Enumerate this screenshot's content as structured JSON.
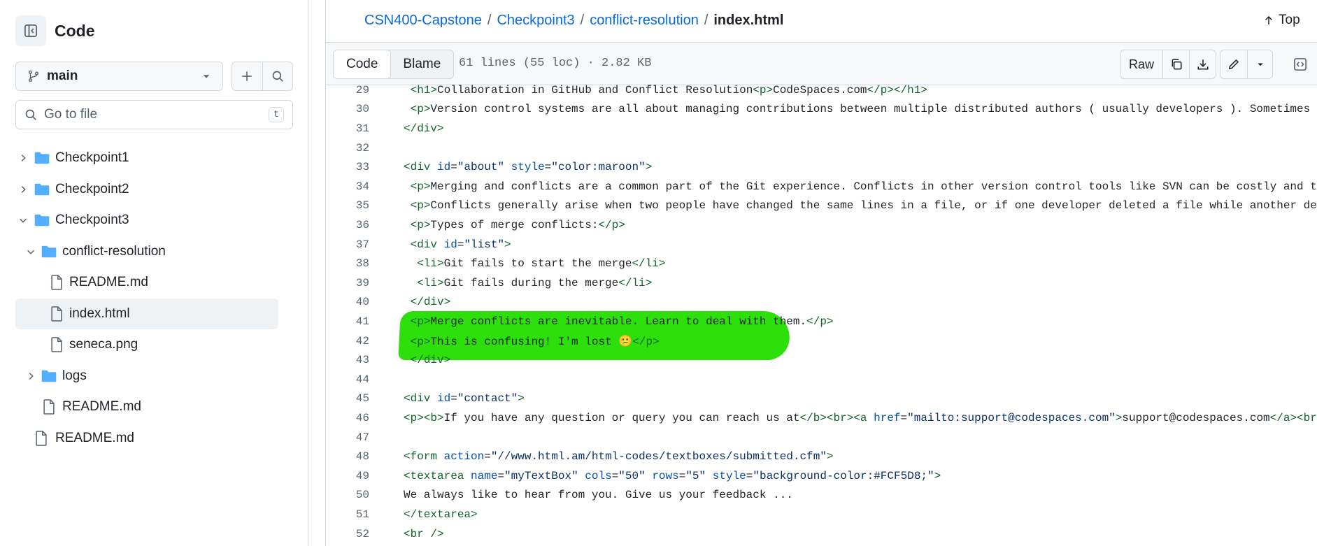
{
  "sidebar": {
    "title": "Code",
    "branch": "main",
    "search": {
      "placeholder": "Go to file",
      "shortcut": "t"
    },
    "tree": [
      {
        "label": "Checkpoint1",
        "type": "folder",
        "level": 0,
        "expanded": false
      },
      {
        "label": "Checkpoint2",
        "type": "folder",
        "level": 0,
        "expanded": false
      },
      {
        "label": "Checkpoint3",
        "type": "folder",
        "level": 0,
        "expanded": true
      },
      {
        "label": "conflict-resolution",
        "type": "folder",
        "level": 1,
        "expanded": true
      },
      {
        "label": "README.md",
        "type": "file",
        "level": 2
      },
      {
        "label": "index.html",
        "type": "file",
        "level": 2,
        "active": true
      },
      {
        "label": "seneca.png",
        "type": "file",
        "level": 2
      },
      {
        "label": "logs",
        "type": "folder",
        "level": 1,
        "expanded": false
      },
      {
        "label": "README.md",
        "type": "file",
        "level": 1
      },
      {
        "label": "README.md",
        "type": "file",
        "level": 0
      }
    ]
  },
  "breadcrumb": {
    "parts": [
      "CSN400-Capstone",
      "Checkpoint3",
      "conflict-resolution"
    ],
    "separator": "/",
    "current": "index.html"
  },
  "top_link": "Top",
  "toolbar": {
    "code_tab": "Code",
    "blame_tab": "Blame",
    "file_info": "61 lines (55 loc) · 2.82 KB",
    "raw": "Raw"
  },
  "colors": {
    "highlight": "#2de00b",
    "link": "#0969da"
  },
  "code": {
    "lines": [
      {
        "n": "29",
        "html": " <span class='tk-tag'>&lt;h1&gt;</span>Collaboration in GitHub and Conflict Resolution<span class='tk-tag'>&lt;p&gt;</span>CodeSpaces.com<span class='tk-tag'>&lt;/p&gt;&lt;/h1&gt;</span>"
      },
      {
        "n": "30",
        "html": " <span class='tk-tag'>&lt;p&gt;</span>Version control systems are all about managing contributions between multiple distributed authors ( usually developers ). Sometimes multiple"
      },
      {
        "n": "31",
        "html": "<span class='tk-tag'>&lt;/div&gt;</span>"
      },
      {
        "n": "32",
        "html": ""
      },
      {
        "n": "33",
        "html": "<span class='tk-tag'>&lt;div</span> <span class='tk-attr'>id</span>=<span class='tk-str'>\"about\"</span> <span class='tk-attr'>style</span>=<span class='tk-str'>\"color:maroon\"</span><span class='tk-tag'>&gt;</span>"
      },
      {
        "n": "34",
        "html": " <span class='tk-tag'>&lt;p&gt;</span>Merging and conflicts are a common part of the Git experience. Conflicts in other version control tools like SVN can be costly and time-cons"
      },
      {
        "n": "35",
        "html": " <span class='tk-tag'>&lt;p&gt;</span>Conflicts generally arise when two people have changed the same lines in a file, or if one developer deleted a file while another developer"
      },
      {
        "n": "36",
        "html": " <span class='tk-tag'>&lt;p&gt;</span>Types of merge conflicts:<span class='tk-tag'>&lt;/p&gt;</span>"
      },
      {
        "n": "37",
        "html": " <span class='tk-tag'>&lt;div</span> <span class='tk-attr'>id</span>=<span class='tk-str'>\"list\"</span><span class='tk-tag'>&gt;</span>"
      },
      {
        "n": "38",
        "html": "  <span class='tk-tag'>&lt;li&gt;</span>Git fails to start the merge<span class='tk-tag'>&lt;/li&gt;</span>"
      },
      {
        "n": "39",
        "html": "  <span class='tk-tag'>&lt;li&gt;</span>Git fails during the merge<span class='tk-tag'>&lt;/li&gt;</span>"
      },
      {
        "n": "40",
        "html": " <span class='tk-tag'>&lt;/div&gt;</span>"
      },
      {
        "n": "41",
        "html": " <span class='tk-tag'>&lt;p&gt;</span>Merge conflicts are inevitable. Learn to deal with them.<span class='tk-tag'>&lt;/p&gt;</span>"
      },
      {
        "n": "42",
        "html": " <span class='tk-tag'>&lt;p&gt;</span>This is confusing! I'm lost 😕<span class='tk-tag'>&lt;/p&gt;</span>"
      },
      {
        "n": "43",
        "html": " <span class='tk-tag'>&lt;/div&gt;</span>"
      },
      {
        "n": "44",
        "html": ""
      },
      {
        "n": "45",
        "html": "<span class='tk-tag'>&lt;div</span> <span class='tk-attr'>id</span>=<span class='tk-str'>\"contact\"</span><span class='tk-tag'>&gt;</span>"
      },
      {
        "n": "46",
        "html": "<span class='tk-tag'>&lt;p&gt;&lt;b&gt;</span>If you have any question or query you can reach us at<span class='tk-tag'>&lt;/b&gt;&lt;br&gt;&lt;a</span> <span class='tk-attr'>href</span>=<span class='tk-str'>\"mailto:support@codespaces.com\"</span><span class='tk-tag'>&gt;</span>support@codespaces.com<span class='tk-tag'>&lt;/a&gt;&lt;br&gt;&lt;br&gt;&lt;/p</span>"
      },
      {
        "n": "47",
        "html": ""
      },
      {
        "n": "48",
        "html": "<span class='tk-tag'>&lt;form</span> <span class='tk-attr'>action</span>=<span class='tk-str'>\"//www.html.am/html-codes/textboxes/submitted.cfm\"</span><span class='tk-tag'>&gt;</span>"
      },
      {
        "n": "49",
        "html": "<span class='tk-tag'>&lt;textarea</span> <span class='tk-attr'>name</span>=<span class='tk-str'>\"myTextBox\"</span> <span class='tk-attr'>cols</span>=<span class='tk-str'>\"50\"</span> <span class='tk-attr'>rows</span>=<span class='tk-str'>\"5\"</span> <span class='tk-attr'>style</span>=<span class='tk-str'>\"background-color:#FCF5D8;\"</span><span class='tk-tag'>&gt;</span>"
      },
      {
        "n": "50",
        "html": "We always like to hear from you. Give us your feedback ..."
      },
      {
        "n": "51",
        "html": "<span class='tk-tag'>&lt;/textarea&gt;</span>"
      },
      {
        "n": "52",
        "html": "<span class='tk-tag'>&lt;br /&gt;</span>"
      }
    ]
  }
}
